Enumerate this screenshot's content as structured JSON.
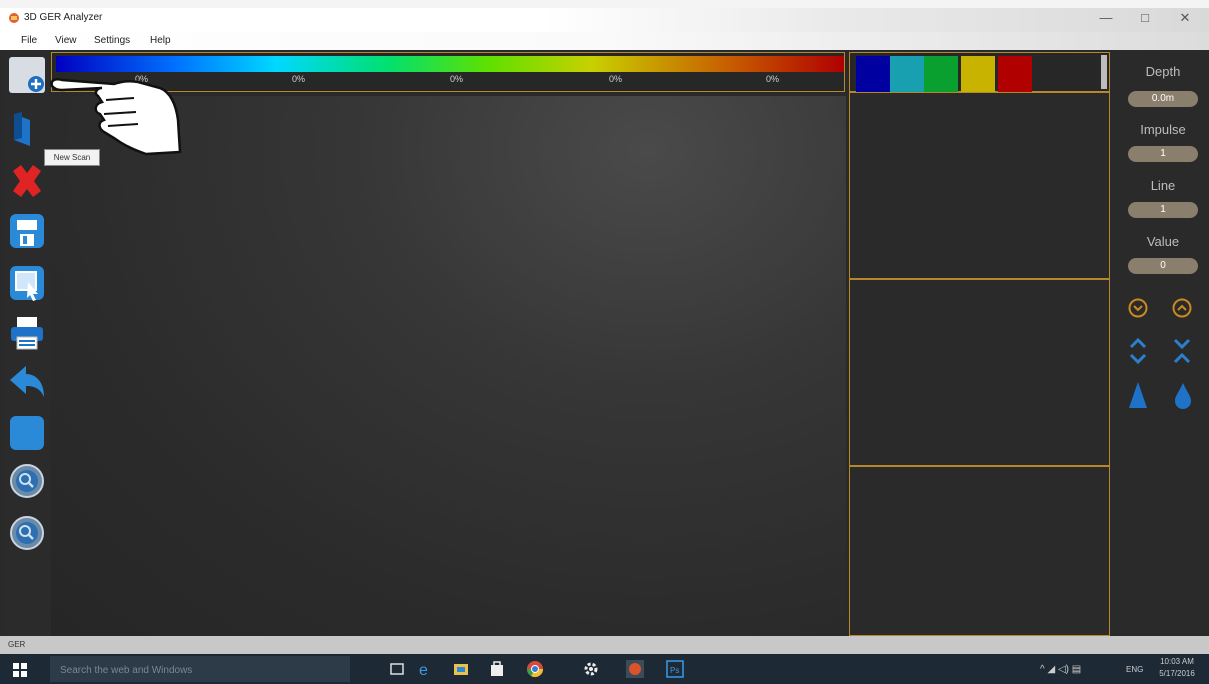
{
  "window": {
    "title": "3D GER Analyzer",
    "min": "—",
    "max": "□",
    "close": "✕"
  },
  "menu": [
    "File",
    "View",
    "Settings",
    "Help"
  ],
  "colorbar": {
    "labels": [
      "0%",
      "0%",
      "0%",
      "0%",
      "0%"
    ]
  },
  "swatches": [
    "#0000a0",
    "#19a0b0",
    "#0aa030",
    "#c8b400",
    "#b00000"
  ],
  "tooltip": "New Scan",
  "readouts": {
    "depth": {
      "label": "Depth",
      "value": "0.0m"
    },
    "impulse": {
      "label": "Impulse",
      "value": "1"
    },
    "line": {
      "label": "Line",
      "value": "1"
    },
    "value": {
      "label": "Value",
      "value": "0"
    }
  },
  "status": "GER",
  "taskbar": {
    "search_placeholder": "Search the web and Windows",
    "time": "10:03 AM",
    "date": "5/17/2016",
    "lang": "ENG"
  },
  "accent": "#b8862b"
}
